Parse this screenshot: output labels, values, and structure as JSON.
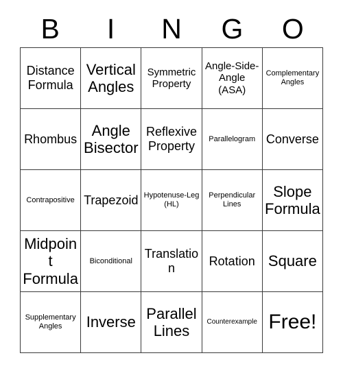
{
  "card": {
    "header_letters": [
      "B",
      "I",
      "N",
      "G",
      "O"
    ],
    "rows": [
      [
        {
          "text": "Distance Formula",
          "size": "md"
        },
        {
          "text": "Vertical Angles",
          "size": "lg"
        },
        {
          "text": "Symmetric Property",
          "size": "sm"
        },
        {
          "text": "Angle-Side-Angle (ASA)",
          "size": "sm"
        },
        {
          "text": "Complementary Angles",
          "size": "xs"
        }
      ],
      [
        {
          "text": "Rhombus",
          "size": "md"
        },
        {
          "text": "Angle Bisector",
          "size": "lg"
        },
        {
          "text": "Reflexive Property",
          "size": "md"
        },
        {
          "text": "Parallelogram",
          "size": "xs"
        },
        {
          "text": "Converse",
          "size": "md"
        }
      ],
      [
        {
          "text": "Contrapositive",
          "size": "xs"
        },
        {
          "text": "Trapezoid",
          "size": "md"
        },
        {
          "text": "Hypotenuse-Leg (HL)",
          "size": "xs"
        },
        {
          "text": "Perpendicular Lines",
          "size": "xs"
        },
        {
          "text": "Slope Formula",
          "size": "lg"
        }
      ],
      [
        {
          "text": "Midpoint Formula",
          "size": "lg"
        },
        {
          "text": "Biconditional",
          "size": "xs"
        },
        {
          "text": "Translation",
          "size": "md"
        },
        {
          "text": "Rotation",
          "size": "md"
        },
        {
          "text": "Square",
          "size": "lg"
        }
      ],
      [
        {
          "text": "Supplementary Angles",
          "size": "xs"
        },
        {
          "text": "Inverse",
          "size": "lg"
        },
        {
          "text": "Parallel Lines",
          "size": "lg"
        },
        {
          "text": "Counterexample",
          "size": "xxs"
        },
        {
          "text": "Free!",
          "size": "xl"
        }
      ]
    ]
  },
  "style": {
    "background_color": "#ffffff",
    "text_color": "#000000",
    "border_color": "#3a3a3a"
  }
}
